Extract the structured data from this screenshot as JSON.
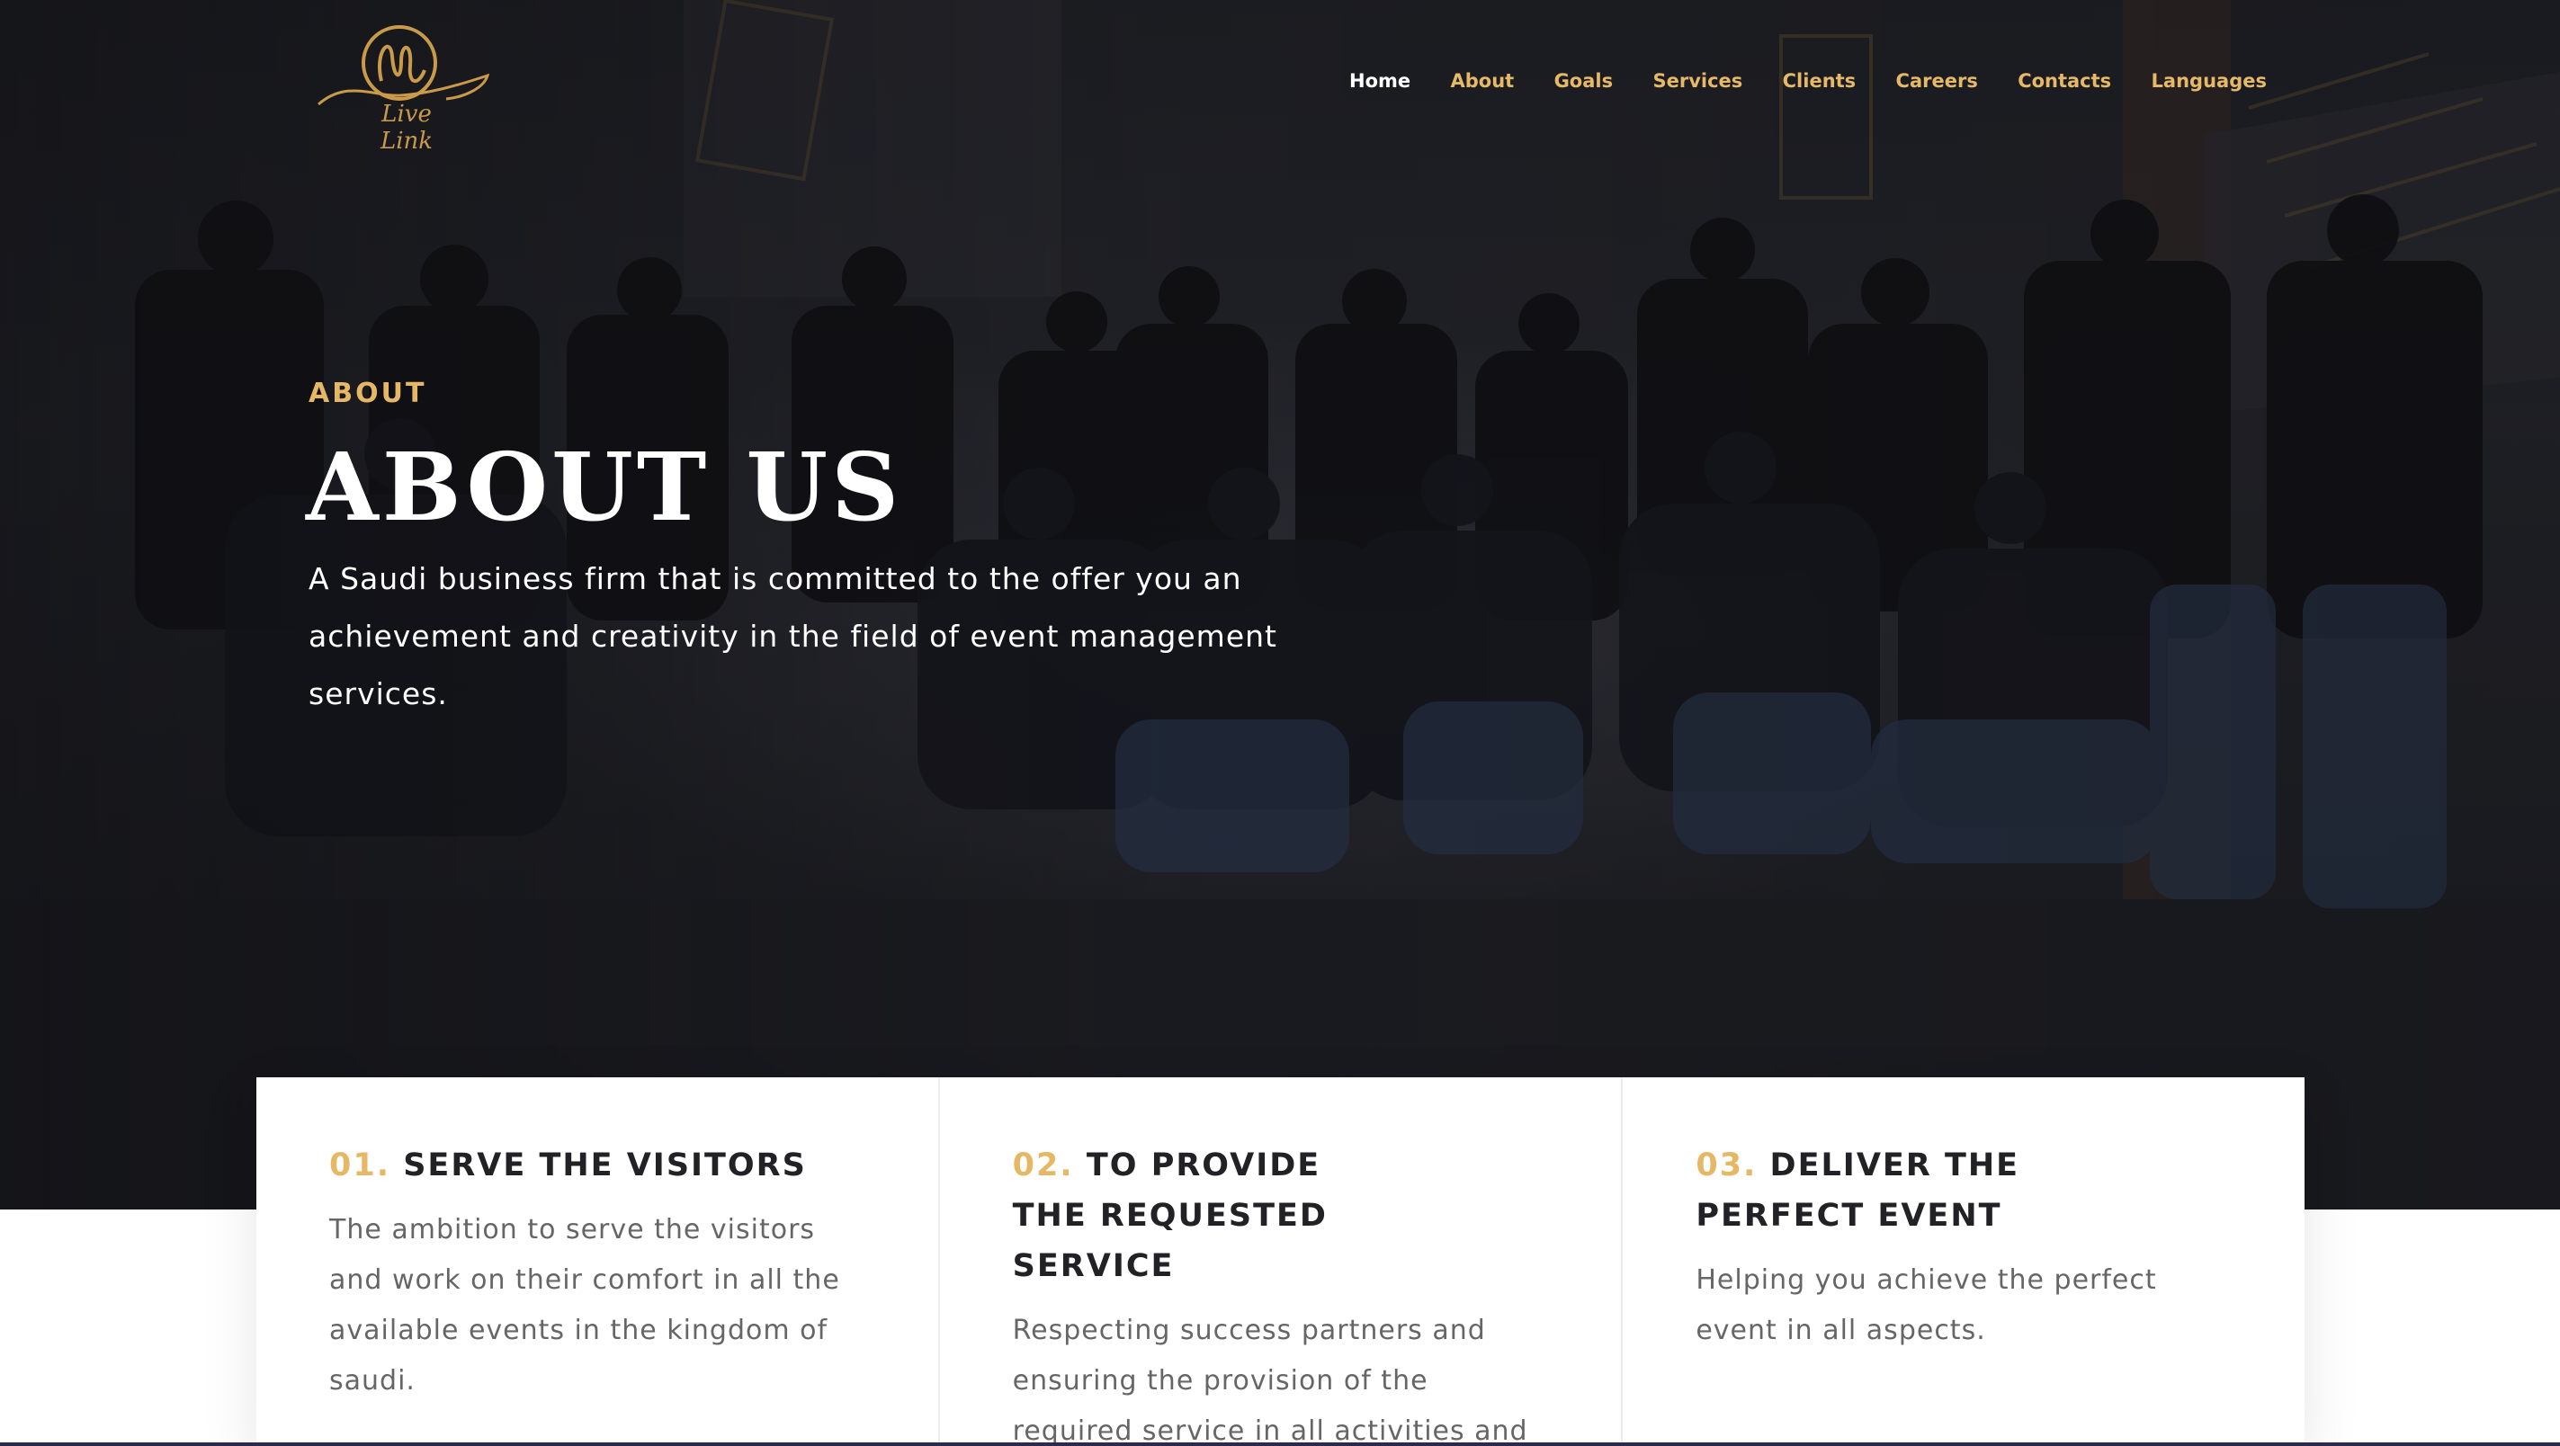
{
  "brand": {
    "logo_text": "Live Link",
    "accent_color": "#e6b866"
  },
  "nav": {
    "items": [
      {
        "label": "Home",
        "active": true
      },
      {
        "label": "About",
        "active": false
      },
      {
        "label": "Goals",
        "active": false
      },
      {
        "label": "Services",
        "active": false
      },
      {
        "label": "Clients",
        "active": false
      },
      {
        "label": "Careers",
        "active": false
      },
      {
        "label": "Contacts",
        "active": false
      },
      {
        "label": "Languages",
        "active": false
      }
    ]
  },
  "hero": {
    "eyebrow": "ABOUT",
    "title": "ABOUT US",
    "description": "A Saudi business firm that is committed to the offer you an achievement and creativity in the field of event management services."
  },
  "cards": [
    {
      "number": "01.",
      "title": "SERVE THE VISITORS",
      "description": "The ambition to serve the visitors and work on their comfort in all the available events in the kingdom of saudi."
    },
    {
      "number": "02.",
      "title": "TO PROVIDE THE REQUESTED SERVICE",
      "description": "Respecting success partners and ensuring the provision of the required service in all activities and"
    },
    {
      "number": "03.",
      "title": "DELIVER THE PERFECT EVENT",
      "description": "Helping you achieve the perfect event in all aspects."
    }
  ]
}
